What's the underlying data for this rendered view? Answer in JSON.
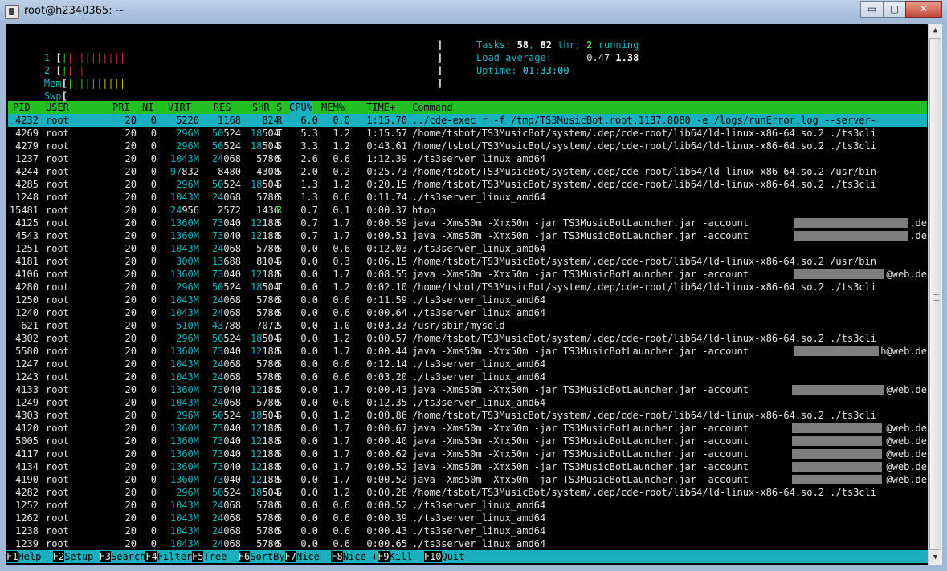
{
  "window": {
    "title": "root@h2340365: ~",
    "btn_min": "▭",
    "btn_max": "▢",
    "btn_close": "✕"
  },
  "meters": {
    "cpu1": {
      "label": "1",
      "bars": [
        {
          "c": "green",
          "n": 1
        },
        {
          "c": "red",
          "n": 10
        }
      ]
    },
    "cpu2": {
      "label": "2",
      "bars": [
        {
          "c": "green",
          "n": 1
        },
        {
          "c": "red",
          "n": 3
        }
      ]
    },
    "mem": {
      "label": "Mem",
      "bars": [
        {
          "c": "green",
          "n": 5
        },
        {
          "c": "blue",
          "n": 1
        },
        {
          "c": "yellow",
          "n": 4
        }
      ]
    },
    "swp": {
      "label": "Swp",
      "bars": []
    }
  },
  "stats": {
    "tasks_label": "Tasks: ",
    "tasks": "58",
    "sep1": ", ",
    "thr": "82",
    "thr_label": " thr; ",
    "running": "2",
    "running_label": " running",
    "load_label": "Load average: ",
    "load1": "0.47",
    "load5": "1.38",
    "uptime_label": "Uptime: ",
    "uptime": "01:33:00"
  },
  "header": {
    "pid": "PID",
    "user": "USER",
    "pri": "PRI",
    "ni": "NI",
    "virt": "VIRT",
    "res": "RES",
    "shr": "SHR",
    "s": "S",
    "cpu": "CPU%",
    "mem": "MEM%",
    "time": "TIME+",
    "command": "Command"
  },
  "processes": [
    {
      "pid": "4232",
      "user": "root",
      "pri": "20",
      "ni": "0",
      "virt": "5220",
      "res": "1168",
      "shr": "824",
      "s": "R",
      "cpu": "6.0",
      "mem": "0.0",
      "time": "1:15.70",
      "cmd": "../cde-exec r -f /tmp/TS3MusicBot.root.1137.8080 -e /logs/runError.log --server-",
      "sel": true
    },
    {
      "pid": "4269",
      "user": "root",
      "pri": "20",
      "ni": "0",
      "virt": "296M",
      "res": "50524",
      "shr": "18504",
      "s": "T",
      "cpu": "5.3",
      "mem": "1.2",
      "time": "1:15.57",
      "cmd": "/home/tsbot/TS3MusicBot/system/.dep/cde-root/lib64/ld-linux-x86-64.so.2 ./ts3cli"
    },
    {
      "pid": "4279",
      "user": "root",
      "pri": "20",
      "ni": "0",
      "virt": "296M",
      "res": "50524",
      "shr": "18504",
      "s": "S",
      "cpu": "3.3",
      "mem": "1.2",
      "time": "0:43.61",
      "cmd": "/home/tsbot/TS3MusicBot/system/.dep/cde-root/lib64/ld-linux-x86-64.so.2 ./ts3cli"
    },
    {
      "pid": "1237",
      "user": "root",
      "pri": "20",
      "ni": "0",
      "virt": "1043M",
      "res": "24068",
      "shr": "5780",
      "s": "S",
      "cpu": "2.6",
      "mem": "0.6",
      "time": "1:12.39",
      "cmd": "./ts3server_linux_amd64"
    },
    {
      "pid": "4244",
      "user": "root",
      "pri": "20",
      "ni": "0",
      "virt": "97832",
      "res": "8480",
      "shr": "4308",
      "s": "S",
      "cpu": "2.0",
      "mem": "0.2",
      "time": "0:25.73",
      "cmd": "/home/tsbot/TS3MusicBot/system/.dep/cde-root/lib64/ld-linux-x86-64.so.2 /usr/bin"
    },
    {
      "pid": "4285",
      "user": "root",
      "pri": "20",
      "ni": "0",
      "virt": "296M",
      "res": "50524",
      "shr": "18504",
      "s": "S",
      "cpu": "1.3",
      "mem": "1.2",
      "time": "0:20.15",
      "cmd": "/home/tsbot/TS3MusicBot/system/.dep/cde-root/lib64/ld-linux-x86-64.so.2 ./ts3cli"
    },
    {
      "pid": "1248",
      "user": "root",
      "pri": "20",
      "ni": "0",
      "virt": "1043M",
      "res": "24068",
      "shr": "5780",
      "s": "S",
      "cpu": "1.3",
      "mem": "0.6",
      "time": "0:11.74",
      "cmd": "./ts3server_linux_amd64"
    },
    {
      "pid": "15481",
      "user": "root",
      "pri": "20",
      "ni": "0",
      "virt": "24956",
      "res": "2572",
      "shr": "1436",
      "s": "R",
      "cpu": "0.7",
      "mem": "0.1",
      "time": "0:00.37",
      "cmd": "htop"
    },
    {
      "pid": "4125",
      "user": "root",
      "pri": "20",
      "ni": "0",
      "virt": "1360M",
      "res": "73040",
      "shr": "12188",
      "s": "S",
      "cpu": "0.7",
      "mem": "1.7",
      "time": "0:00.59",
      "cmd": "java -Xms50m -Xmx50m -jar TS3MusicBotLauncher.jar -account",
      "tail": ".de",
      "redact": [
        986,
        142
      ]
    },
    {
      "pid": "4543",
      "user": "root",
      "pri": "20",
      "ni": "0",
      "virt": "1360M",
      "res": "73040",
      "shr": "12188",
      "s": "S",
      "cpu": "0.7",
      "mem": "1.7",
      "time": "0:00.51",
      "cmd": "java -Xms50m -Xmx50m -jar TS3MusicBotLauncher.jar -account",
      "tail": ".de",
      "redact": [
        986,
        142
      ]
    },
    {
      "pid": "1251",
      "user": "root",
      "pri": "20",
      "ni": "0",
      "virt": "1043M",
      "res": "24068",
      "shr": "5780",
      "s": "S",
      "cpu": "0.0",
      "mem": "0.6",
      "time": "0:12.03",
      "cmd": "./ts3server_linux_amd64"
    },
    {
      "pid": "4181",
      "user": "root",
      "pri": "20",
      "ni": "0",
      "virt": "300M",
      "res": "13688",
      "shr": "8104",
      "s": "S",
      "cpu": "0.0",
      "mem": "0.3",
      "time": "0:06.15",
      "cmd": "/home/tsbot/TS3MusicBot/system/.dep/cde-root/lib64/ld-linux-x86-64.so.2 /usr/bin"
    },
    {
      "pid": "4106",
      "user": "root",
      "pri": "20",
      "ni": "0",
      "virt": "1360M",
      "res": "73040",
      "shr": "12188",
      "s": "S",
      "cpu": "0.0",
      "mem": "1.7",
      "time": "0:08.55",
      "cmd": "java -Xms50m -Xmx50m -jar TS3MusicBotLauncher.jar -account",
      "tail": "@web.de",
      "redact": [
        986,
        112
      ]
    },
    {
      "pid": "4280",
      "user": "root",
      "pri": "20",
      "ni": "0",
      "virt": "296M",
      "res": "50524",
      "shr": "18504",
      "s": "T",
      "cpu": "0.0",
      "mem": "1.2",
      "time": "0:02.10",
      "cmd": "/home/tsbot/TS3MusicBot/system/.dep/cde-root/lib64/ld-linux-x86-64.so.2 ./ts3cli"
    },
    {
      "pid": "1250",
      "user": "root",
      "pri": "20",
      "ni": "0",
      "virt": "1043M",
      "res": "24068",
      "shr": "5780",
      "s": "S",
      "cpu": "0.0",
      "mem": "0.6",
      "time": "0:11.59",
      "cmd": "./ts3server_linux_amd64"
    },
    {
      "pid": "1240",
      "user": "root",
      "pri": "20",
      "ni": "0",
      "virt": "1043M",
      "res": "24068",
      "shr": "5780",
      "s": "S",
      "cpu": "0.0",
      "mem": "0.6",
      "time": "0:00.64",
      "cmd": "./ts3server_linux_amd64"
    },
    {
      "pid": "621",
      "user": "root",
      "pri": "20",
      "ni": "0",
      "virt": "510M",
      "res": "43788",
      "shr": "7072",
      "s": "S",
      "cpu": "0.0",
      "mem": "1.0",
      "time": "0:03.33",
      "cmd": "/usr/sbin/mysqld"
    },
    {
      "pid": "4302",
      "user": "root",
      "pri": "20",
      "ni": "0",
      "virt": "296M",
      "res": "50524",
      "shr": "18504",
      "s": "S",
      "cpu": "0.0",
      "mem": "1.2",
      "time": "0:00.57",
      "cmd": "/home/tsbot/TS3MusicBot/system/.dep/cde-root/lib64/ld-linux-x86-64.so.2 ./ts3cli"
    },
    {
      "pid": "5580",
      "user": "root",
      "pri": "20",
      "ni": "0",
      "virt": "1360M",
      "res": "73040",
      "shr": "12188",
      "s": "S",
      "cpu": "0.0",
      "mem": "1.7",
      "time": "0:00.44",
      "cmd": "java -Xms50m -Xmx50m -jar TS3MusicBotLauncher.jar -account",
      "tail": "h@web.de",
      "redact": [
        986,
        106
      ]
    },
    {
      "pid": "1247",
      "user": "root",
      "pri": "20",
      "ni": "0",
      "virt": "1043M",
      "res": "24068",
      "shr": "5780",
      "s": "S",
      "cpu": "0.0",
      "mem": "0.6",
      "time": "0:12.14",
      "cmd": "./ts3server_linux_amd64"
    },
    {
      "pid": "1243",
      "user": "root",
      "pri": "20",
      "ni": "0",
      "virt": "1043M",
      "res": "24068",
      "shr": "5780",
      "s": "S",
      "cpu": "0.0",
      "mem": "0.6",
      "time": "0:03.20",
      "cmd": "./ts3server_linux_amd64"
    },
    {
      "pid": "4133",
      "user": "root",
      "pri": "20",
      "ni": "0",
      "virt": "1360M",
      "res": "73040",
      "shr": "12188",
      "s": "S",
      "cpu": "0.0",
      "mem": "1.7",
      "time": "0:00.43",
      "cmd": "java -Xms50m -Xmx50m -jar TS3MusicBotLauncher.jar -account",
      "tail": "@web.de",
      "redact": [
        984,
        114
      ]
    },
    {
      "pid": "1249",
      "user": "root",
      "pri": "20",
      "ni": "0",
      "virt": "1043M",
      "res": "24068",
      "shr": "5780",
      "s": "S",
      "cpu": "0.0",
      "mem": "0.6",
      "time": "0:12.35",
      "cmd": "./ts3server_linux_amd64"
    },
    {
      "pid": "4303",
      "user": "root",
      "pri": "20",
      "ni": "0",
      "virt": "296M",
      "res": "50524",
      "shr": "18504",
      "s": "S",
      "cpu": "0.0",
      "mem": "1.2",
      "time": "0:00.86",
      "cmd": "/home/tsbot/TS3MusicBot/system/.dep/cde-root/lib64/ld-linux-x86-64.so.2 ./ts3cli"
    },
    {
      "pid": "4120",
      "user": "root",
      "pri": "20",
      "ni": "0",
      "virt": "1360M",
      "res": "73040",
      "shr": "12188",
      "s": "S",
      "cpu": "0.0",
      "mem": "1.7",
      "time": "0:00.67",
      "cmd": "java -Xms50m -Xmx50m -jar TS3MusicBotLauncher.jar -account",
      "tail": "@web.de",
      "redact": [
        984,
        112
      ]
    },
    {
      "pid": "5005",
      "user": "root",
      "pri": "20",
      "ni": "0",
      "virt": "1360M",
      "res": "73040",
      "shr": "12188",
      "s": "S",
      "cpu": "0.0",
      "mem": "1.7",
      "time": "0:00.40",
      "cmd": "java -Xms50m -Xmx50m -jar TS3MusicBotLauncher.jar -account",
      "tail": "@web.de",
      "redact": [
        984,
        112
      ]
    },
    {
      "pid": "4117",
      "user": "root",
      "pri": "20",
      "ni": "0",
      "virt": "1360M",
      "res": "73040",
      "shr": "12188",
      "s": "S",
      "cpu": "0.0",
      "mem": "1.7",
      "time": "0:00.62",
      "cmd": "java -Xms50m -Xmx50m -jar TS3MusicBotLauncher.jar -account",
      "tail": "@web.de",
      "redact": [
        984,
        112
      ]
    },
    {
      "pid": "4134",
      "user": "root",
      "pri": "20",
      "ni": "0",
      "virt": "1360M",
      "res": "73040",
      "shr": "12188",
      "s": "S",
      "cpu": "0.0",
      "mem": "1.7",
      "time": "0:00.52",
      "cmd": "java -Xms50m -Xmx50m -jar TS3MusicBotLauncher.jar -account",
      "tail": "@web.de",
      "redact": [
        984,
        112
      ]
    },
    {
      "pid": "4190",
      "user": "root",
      "pri": "20",
      "ni": "0",
      "virt": "1360M",
      "res": "73040",
      "shr": "12188",
      "s": "S",
      "cpu": "0.0",
      "mem": "1.7",
      "time": "0:00.52",
      "cmd": "java -Xms50m -Xmx50m -jar TS3MusicBotLauncher.jar -account",
      "tail": "@web.de",
      "redact": [
        984,
        112
      ]
    },
    {
      "pid": "4282",
      "user": "root",
      "pri": "20",
      "ni": "0",
      "virt": "296M",
      "res": "50524",
      "shr": "18504",
      "s": "S",
      "cpu": "0.0",
      "mem": "1.2",
      "time": "0:00.28",
      "cmd": "/home/tsbot/TS3MusicBot/system/.dep/cde-root/lib64/ld-linux-x86-64.so.2 ./ts3cli"
    },
    {
      "pid": "1252",
      "user": "root",
      "pri": "20",
      "ni": "0",
      "virt": "1043M",
      "res": "24068",
      "shr": "5780",
      "s": "S",
      "cpu": "0.0",
      "mem": "0.6",
      "time": "0:00.52",
      "cmd": "./ts3server_linux_amd64"
    },
    {
      "pid": "1262",
      "user": "root",
      "pri": "20",
      "ni": "0",
      "virt": "1043M",
      "res": "24068",
      "shr": "5780",
      "s": "S",
      "cpu": "0.0",
      "mem": "0.6",
      "time": "0:00.39",
      "cmd": "./ts3server_linux_amd64"
    },
    {
      "pid": "1238",
      "user": "root",
      "pri": "20",
      "ni": "0",
      "virt": "1043M",
      "res": "24068",
      "shr": "5780",
      "s": "S",
      "cpu": "0.0",
      "mem": "0.6",
      "time": "0:00.43",
      "cmd": "./ts3server_linux_amd64"
    },
    {
      "pid": "1239",
      "user": "root",
      "pri": "20",
      "ni": "0",
      "virt": "1043M",
      "res": "24068",
      "shr": "5780",
      "s": "S",
      "cpu": "0.0",
      "mem": "0.6",
      "time": "0:00.65",
      "cmd": "./ts3server_linux_amd64"
    }
  ],
  "function_keys": [
    {
      "key": "F1",
      "label": "Help  "
    },
    {
      "key": "F2",
      "label": "Setup "
    },
    {
      "key": "F3",
      "label": "Search"
    },
    {
      "key": "F4",
      "label": "Filter"
    },
    {
      "key": "F5",
      "label": "Tree  "
    },
    {
      "key": "F6",
      "label": "SortBy"
    },
    {
      "key": "F7",
      "label": "Nice -"
    },
    {
      "key": "F8",
      "label": "Nice +"
    },
    {
      "key": "F9",
      "label": "Kill  "
    },
    {
      "key": "F10",
      "label": "Quit  "
    }
  ],
  "colors": {
    "terminal_bg": "#000000",
    "cyan": "#1ab0c0",
    "green": "#22c022",
    "redaction": "#7d7d7d"
  }
}
